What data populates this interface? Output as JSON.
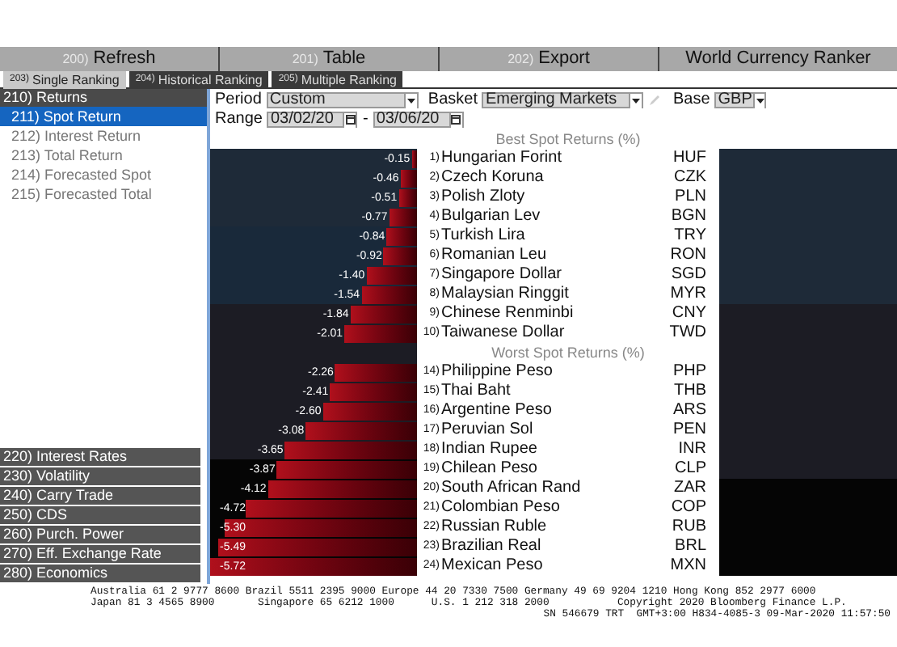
{
  "toolbar": [
    {
      "number": "200)",
      "label": "Refresh"
    },
    {
      "number": "201)",
      "label": "Table"
    },
    {
      "number": "202)",
      "label": "Export"
    }
  ],
  "title": "World Currency Ranker",
  "tabs": [
    {
      "number": "203)",
      "label": "Single Ranking",
      "selected": true
    },
    {
      "number": "204)",
      "label": "Historical Ranking",
      "selected": false
    },
    {
      "number": "205)",
      "label": "Multiple Ranking",
      "selected": false
    }
  ],
  "sidebar": {
    "header": "210) Returns",
    "items": [
      {
        "label": "211) Spot Return",
        "selected": true
      },
      {
        "label": "212) Interest Return",
        "selected": false
      },
      {
        "label": "213) Total Return",
        "selected": false
      },
      {
        "label": "214) Forecasted Spot",
        "selected": false
      },
      {
        "label": "215) Forecasted Total",
        "selected": false
      }
    ],
    "sections": [
      "220) Interest Rates",
      "230) Volatility",
      "240) Carry Trade",
      "250) CDS",
      "260) Purch. Power",
      "270) Eff. Exchange Rate",
      "280) Economics"
    ]
  },
  "filters": {
    "period": {
      "label": "Period",
      "value": "Custom"
    },
    "basket": {
      "label": "Basket",
      "value": "Emerging Markets"
    },
    "base": {
      "label": "Base",
      "value": "GBP"
    },
    "range": {
      "label": "Range",
      "from": "03/02/20",
      "separator": "-",
      "to": "03/06/20"
    }
  },
  "sections": [
    {
      "title": "Best Spot Returns (%)",
      "rows": [
        {
          "rank": "1)",
          "name": "Hungarian Forint",
          "code": "HUF",
          "value": "-0.15",
          "level": 0.026
        },
        {
          "rank": "2)",
          "name": "Czech Koruna",
          "code": "CZK",
          "value": "-0.46",
          "level": 0.08
        },
        {
          "rank": "3)",
          "name": "Polish Zloty",
          "code": "PLN",
          "value": "-0.51",
          "level": 0.089
        },
        {
          "rank": "4)",
          "name": "Bulgarian Lev",
          "code": "BGN",
          "value": "-0.77",
          "level": 0.135
        },
        {
          "rank": "5)",
          "name": "Turkish Lira",
          "code": "TRY",
          "value": "-0.84",
          "level": 0.147
        },
        {
          "rank": "6)",
          "name": "Romanian Leu",
          "code": "RON",
          "value": "-0.92",
          "level": 0.161
        },
        {
          "rank": "7)",
          "name": "Singapore Dollar",
          "code": "SGD",
          "value": "-1.40",
          "level": 0.245
        },
        {
          "rank": "8)",
          "name": "Malaysian Ringgit",
          "code": "MYR",
          "value": "-1.54",
          "level": 0.269
        },
        {
          "rank": "9)",
          "name": "Chinese Renminbi",
          "code": "CNY",
          "value": "-1.84",
          "level": 0.322
        },
        {
          "rank": "10)",
          "name": "Taiwanese Dollar",
          "code": "TWD",
          "value": "-2.01",
          "level": 0.351
        }
      ]
    },
    {
      "title": "Worst Spot Returns (%)",
      "rows": [
        {
          "rank": "14)",
          "name": "Philippine Peso",
          "code": "PHP",
          "value": "-2.26",
          "level": 0.395
        },
        {
          "rank": "15)",
          "name": "Thai Baht",
          "code": "THB",
          "value": "-2.41",
          "level": 0.421
        },
        {
          "rank": "16)",
          "name": "Argentine Peso",
          "code": "ARS",
          "value": "-2.60",
          "level": 0.455
        },
        {
          "rank": "17)",
          "name": "Peruvian Sol",
          "code": "PEN",
          "value": "-3.08",
          "level": 0.538
        },
        {
          "rank": "18)",
          "name": "Indian Rupee",
          "code": "INR",
          "value": "-3.65",
          "level": 0.638
        },
        {
          "rank": "19)",
          "name": "Chilean Peso",
          "code": "CLP",
          "value": "-3.87",
          "level": 0.677
        },
        {
          "rank": "20)",
          "name": "South African Rand",
          "code": "ZAR",
          "value": "-4.12",
          "level": 0.72
        },
        {
          "rank": "21)",
          "name": "Colombian Peso",
          "code": "COP",
          "value": "-4.72",
          "level": 0.825
        },
        {
          "rank": "22)",
          "name": "Russian Ruble",
          "code": "RUB",
          "value": "-5.30",
          "level": 0.927
        },
        {
          "rank": "23)",
          "name": "Brazilian Real",
          "code": "BRL",
          "value": "-5.49",
          "level": 0.96
        },
        {
          "rank": "24)",
          "name": "Mexican Peso",
          "code": "MXN",
          "value": "-5.72",
          "level": 1.0
        }
      ]
    }
  ],
  "footer": [
    "Australia 61 2 9777 8600 Brazil 5511 2395 9000 Europe 44 20 7330 7500 Germany 49 69 9204 1210 Hong Kong 852 2977 6000",
    "Japan 81 3 4565 8900       Singapore 65 6212 1000      U.S. 1 212 318 2000           Copyright 2020 Bloomberg Finance L.P.",
    "SN 546679 TRT  GMT+3:00 H834-4085-3 09-Mar-2020 11:57:50"
  ]
}
